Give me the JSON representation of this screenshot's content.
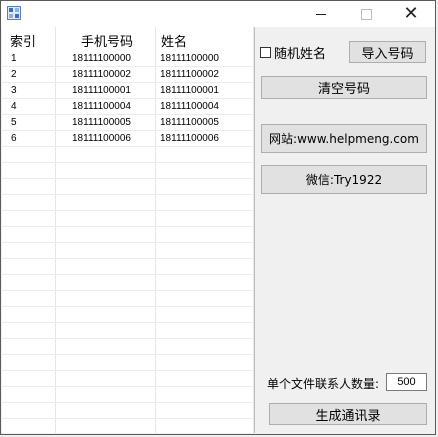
{
  "window": {
    "title": "",
    "icon": "app-icon",
    "controls": [
      "minimize",
      "maximize",
      "close"
    ]
  },
  "table": {
    "headers": [
      "索引",
      "手机号码",
      "姓名"
    ],
    "rows": [
      [
        "1",
        "18111100000",
        "18111100000"
      ],
      [
        "2",
        "18111100002",
        "18111100002"
      ],
      [
        "3",
        "18111100001",
        "18111100001"
      ],
      [
        "4",
        "18111100004",
        "18111100004"
      ],
      [
        "5",
        "18111100005",
        "18111100005"
      ],
      [
        "6",
        "18111100006",
        "18111100006"
      ]
    ]
  },
  "controls": {
    "random_name_label": "随机姓名",
    "random_name_checked": false,
    "import_label": "导入号码",
    "clear_label": "清空号码",
    "website_label": "网站:www.helpmeng.com",
    "wechat_label": "微信:Try1922",
    "count_label": "单个文件联系人数量:",
    "count_value": "500",
    "generate_label": "生成通讯录"
  }
}
